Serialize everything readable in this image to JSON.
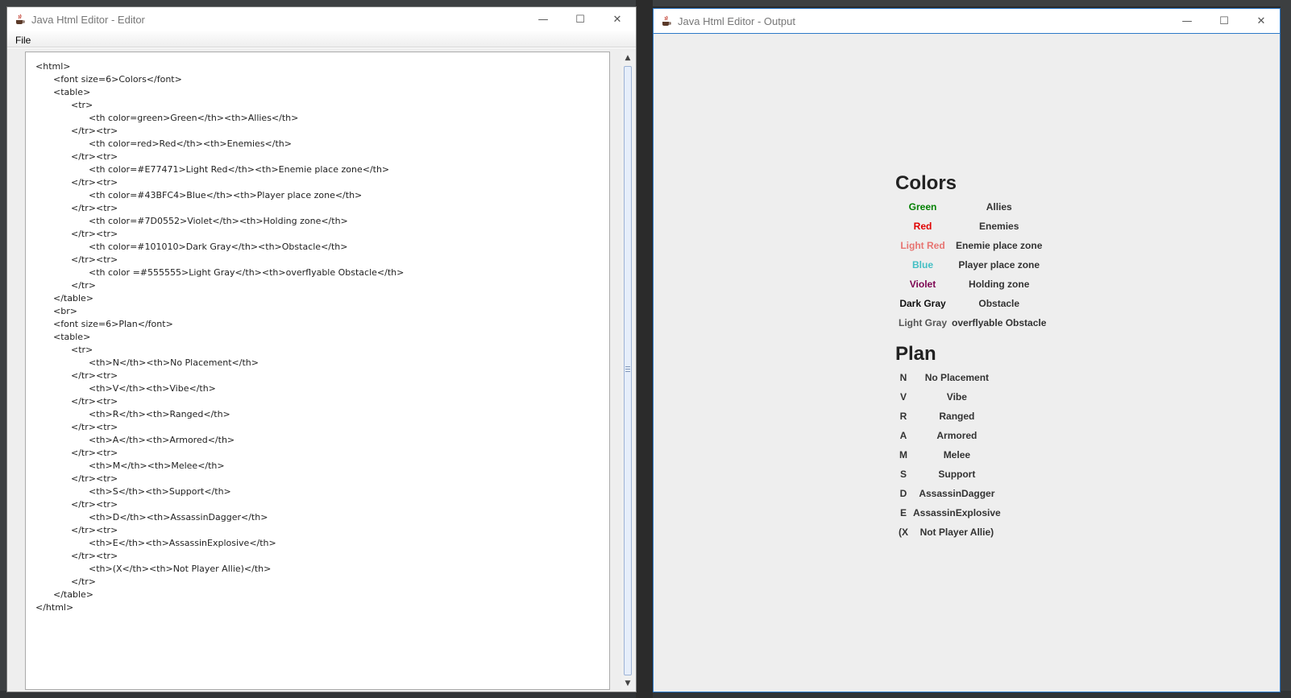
{
  "editor_window": {
    "title": "Java Html Editor - Editor",
    "menu": [
      "File"
    ],
    "code_lines": [
      {
        "indent": 0,
        "text": "<html>"
      },
      {
        "indent": 1,
        "text": "<font size=6>Colors</font>"
      },
      {
        "indent": 1,
        "text": "<table>"
      },
      {
        "indent": 2,
        "text": "<tr>"
      },
      {
        "indent": 3,
        "text": "<th color=green>Green</th><th>Allies</th>"
      },
      {
        "indent": 2,
        "text": "</tr><tr>"
      },
      {
        "indent": 3,
        "text": "<th color=red>Red</th><th>Enemies</th>"
      },
      {
        "indent": 2,
        "text": "</tr><tr>"
      },
      {
        "indent": 3,
        "text": "<th color=#E77471>Light Red</th><th>Enemie place zone</th>"
      },
      {
        "indent": 2,
        "text": "</tr><tr>"
      },
      {
        "indent": 3,
        "text": "<th color=#43BFC4>Blue</th><th>Player place zone</th>"
      },
      {
        "indent": 2,
        "text": "</tr><tr>"
      },
      {
        "indent": 3,
        "text": "<th color=#7D0552>Violet</th><th>Holding zone</th>"
      },
      {
        "indent": 2,
        "text": "</tr><tr>"
      },
      {
        "indent": 3,
        "text": "<th color=#101010>Dark Gray</th><th>Obstacle</th>"
      },
      {
        "indent": 2,
        "text": "</tr><tr>"
      },
      {
        "indent": 3,
        "text": "<th color =#555555>Light Gray</th><th>overflyable Obstacle</th>"
      },
      {
        "indent": 2,
        "text": "</tr>"
      },
      {
        "indent": 1,
        "text": "</table>"
      },
      {
        "indent": 1,
        "text": "<br>"
      },
      {
        "indent": 1,
        "text": "<font size=6>Plan</font>"
      },
      {
        "indent": 1,
        "text": "<table>"
      },
      {
        "indent": 2,
        "text": "<tr>"
      },
      {
        "indent": 3,
        "text": "<th>N</th><th>No Placement</th>"
      },
      {
        "indent": 2,
        "text": "</tr><tr>"
      },
      {
        "indent": 3,
        "text": "<th>V</th><th>Vibe</th>"
      },
      {
        "indent": 2,
        "text": "</tr><tr>"
      },
      {
        "indent": 3,
        "text": "<th>R</th><th>Ranged</th>"
      },
      {
        "indent": 2,
        "text": "</tr><tr>"
      },
      {
        "indent": 3,
        "text": "<th>A</th><th>Armored</th>"
      },
      {
        "indent": 2,
        "text": "</tr><tr>"
      },
      {
        "indent": 3,
        "text": "<th>M</th><th>Melee</th>"
      },
      {
        "indent": 2,
        "text": "</tr><tr>"
      },
      {
        "indent": 3,
        "text": "<th>S</th><th>Support</th>"
      },
      {
        "indent": 2,
        "text": "</tr><tr>"
      },
      {
        "indent": 3,
        "text": "<th>D</th><th>AssassinDagger</th>"
      },
      {
        "indent": 2,
        "text": "</tr><tr>"
      },
      {
        "indent": 3,
        "text": "<th>E</th><th>AssassinExplosive</th>"
      },
      {
        "indent": 2,
        "text": "</tr><tr>"
      },
      {
        "indent": 3,
        "text": "<th>(X</th><th>Not Player Allie)</th>"
      },
      {
        "indent": 2,
        "text": "</tr>"
      },
      {
        "indent": 1,
        "text": "</table>"
      },
      {
        "indent": 0,
        "text": "</html>"
      }
    ]
  },
  "output_window": {
    "title": "Java Html Editor - Output",
    "colors_heading": "Colors",
    "colors_rows": [
      {
        "label": "Green",
        "color": "#008000",
        "meaning": "Allies"
      },
      {
        "label": "Red",
        "color": "#e00000",
        "meaning": "Enemies"
      },
      {
        "label": "Light Red",
        "color": "#E77471",
        "meaning": "Enemie place zone"
      },
      {
        "label": "Blue",
        "color": "#43BFC4",
        "meaning": "Player place zone"
      },
      {
        "label": "Violet",
        "color": "#7D0552",
        "meaning": "Holding zone"
      },
      {
        "label": "Dark Gray",
        "color": "#101010",
        "meaning": "Obstacle"
      },
      {
        "label": "Light Gray",
        "color": "#555555",
        "meaning": "overflyable Obstacle"
      }
    ],
    "plan_heading": "Plan",
    "plan_rows": [
      {
        "code": "N",
        "meaning": "No Placement"
      },
      {
        "code": "V",
        "meaning": "Vibe"
      },
      {
        "code": "R",
        "meaning": "Ranged"
      },
      {
        "code": "A",
        "meaning": "Armored"
      },
      {
        "code": "M",
        "meaning": "Melee"
      },
      {
        "code": "S",
        "meaning": "Support"
      },
      {
        "code": "D",
        "meaning": "AssassinDagger"
      },
      {
        "code": "E",
        "meaning": "AssassinExplosive"
      },
      {
        "code": "(X",
        "meaning": "Not Player Allie)"
      }
    ]
  },
  "window_controls": {
    "minimize": "—",
    "maximize": "☐",
    "close": "✕"
  },
  "icons": {
    "app": "java-coffee-cup-icon"
  }
}
